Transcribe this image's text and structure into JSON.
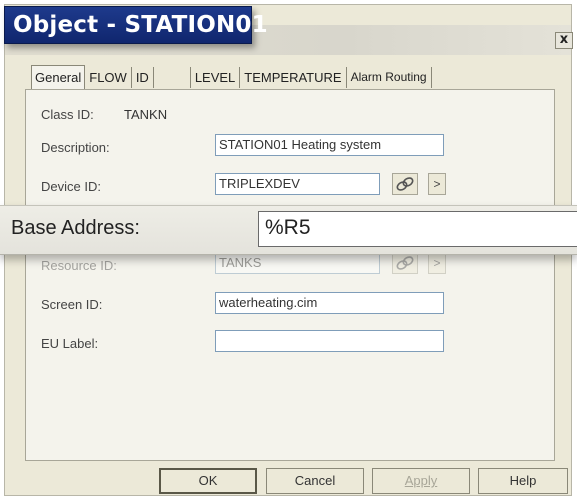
{
  "window": {
    "title": "Object - STATION01",
    "close_glyph": "x"
  },
  "tabs": [
    {
      "label": "General",
      "active": true
    },
    {
      "label": "FLOW",
      "active": false
    },
    {
      "label": "ID",
      "active": false
    },
    {
      "label": "",
      "active": false
    },
    {
      "label": "LEVEL",
      "active": false
    },
    {
      "label": "TEMPERATURE",
      "active": false
    },
    {
      "label": "Alarm Routing",
      "active": false
    }
  ],
  "general": {
    "class_id_label": "Class ID:",
    "class_id_value": "TANKN",
    "description_label": "Description:",
    "description_value": "STATION01 Heating system",
    "device_id_label": "Device ID:",
    "device_id_value": "TRIPLEXDEV",
    "base_address_label": "Base Address:",
    "base_address_value": "%R5",
    "resource_id_label": "Resource ID:",
    "resource_id_value": "TANKS",
    "screen_id_label": "Screen ID:",
    "screen_id_value": "waterheating.cim",
    "eu_label_label": "EU Label:",
    "eu_label_value": "",
    "browse_glyph": ">"
  },
  "buttons": {
    "ok": "OK",
    "cancel": "Cancel",
    "apply": "Apply",
    "help": "Help"
  },
  "icons": {
    "browse_icon": "browse-chain-icon",
    "close_icon": "close-icon"
  },
  "colors": {
    "title_bg": "#1e3a8c",
    "dialog_bg": "#ece9d8",
    "field_border": "#7f9db9"
  }
}
